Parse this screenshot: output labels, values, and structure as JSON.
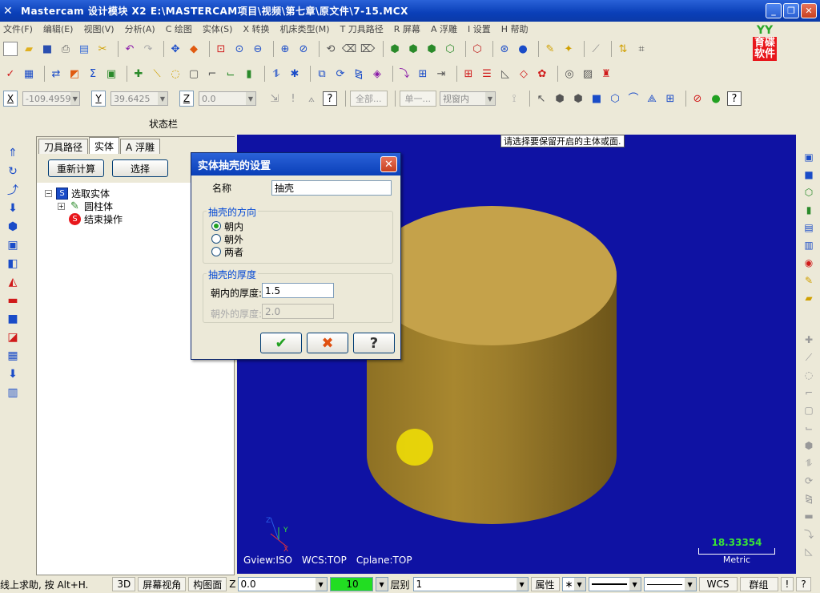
{
  "window": {
    "title": "Mastercam 设计模块  X2  E:\\MASTERCAM项目\\视频\\第七章\\原文件\\7-15.MCX",
    "buttons": [
      "_",
      "❐",
      "✕"
    ]
  },
  "menu": [
    "文件(F)",
    "编辑(E)",
    "视图(V)",
    "分析(A)",
    "C 绘图",
    "实体(S)",
    "X 转换",
    "机床类型(M)",
    "T 刀具路径",
    "R 屏幕",
    "A 浮雕",
    "I 设置",
    "H 帮助"
  ],
  "logo": {
    "top": "YY",
    "text": "育碟\n软件"
  },
  "coords": {
    "x_label": "X",
    "x_value": "-109.4959",
    "y_label": "Y",
    "y_value": "39.6425",
    "z_label": "Z",
    "z_value": "0.0",
    "all_btn": "全部...",
    "single_btn": "单一...",
    "view_select": "视窗内"
  },
  "status_label": "状态栏",
  "panel": {
    "tabs": [
      "刀具路径",
      "实体",
      "A 浮雕"
    ],
    "recalc_btn": "重新计算",
    "select_btn": "选择",
    "tree": [
      {
        "label": "选取实体",
        "icon": "S"
      },
      {
        "label": "圆柱体",
        "icon": "✎"
      },
      {
        "label": "结束操作",
        "icon": "S"
      }
    ]
  },
  "viewport": {
    "prompt": "请选择要保留开启的主体或面.",
    "gview": "Gview:ISO",
    "wcs": "WCS:TOP",
    "cplane": "Cplane:TOP",
    "scale_value": "18.33354",
    "scale_unit": "Metric",
    "axes": {
      "y": "Y",
      "x": "X",
      "z": "Z"
    },
    "bg_color": "#0f12a3",
    "solid_color": "#a0822e"
  },
  "dialog": {
    "title": "实体抽壳的设置",
    "name_label": "名称",
    "name_value": "抽壳",
    "direction_group": "抽壳的方向",
    "options": [
      "朝内",
      "朝外",
      "两者"
    ],
    "selected_option": "朝内",
    "thickness_group": "抽壳的厚度",
    "inward_label": "朝内的厚度:",
    "inward_value": "1.5",
    "outward_label": "朝外的厚度:",
    "outward_value": "2.0",
    "ok_icon": "✔",
    "cancel_icon": "✖",
    "help_icon": "?"
  },
  "bottom": {
    "help_text": "线上求助, 按 Alt+H.",
    "btn_3d": "3D",
    "btn_screen": "屏幕视角",
    "btn_plane": "构图面",
    "z_label": "Z",
    "z_value": "0.0",
    "color_value": "10",
    "layer_label": "层别",
    "layer_value": "1",
    "attr_label": "属性",
    "wcs_btn": "WCS",
    "group_btn": "群组",
    "excl_btn": "!",
    "q_btn": "?"
  }
}
